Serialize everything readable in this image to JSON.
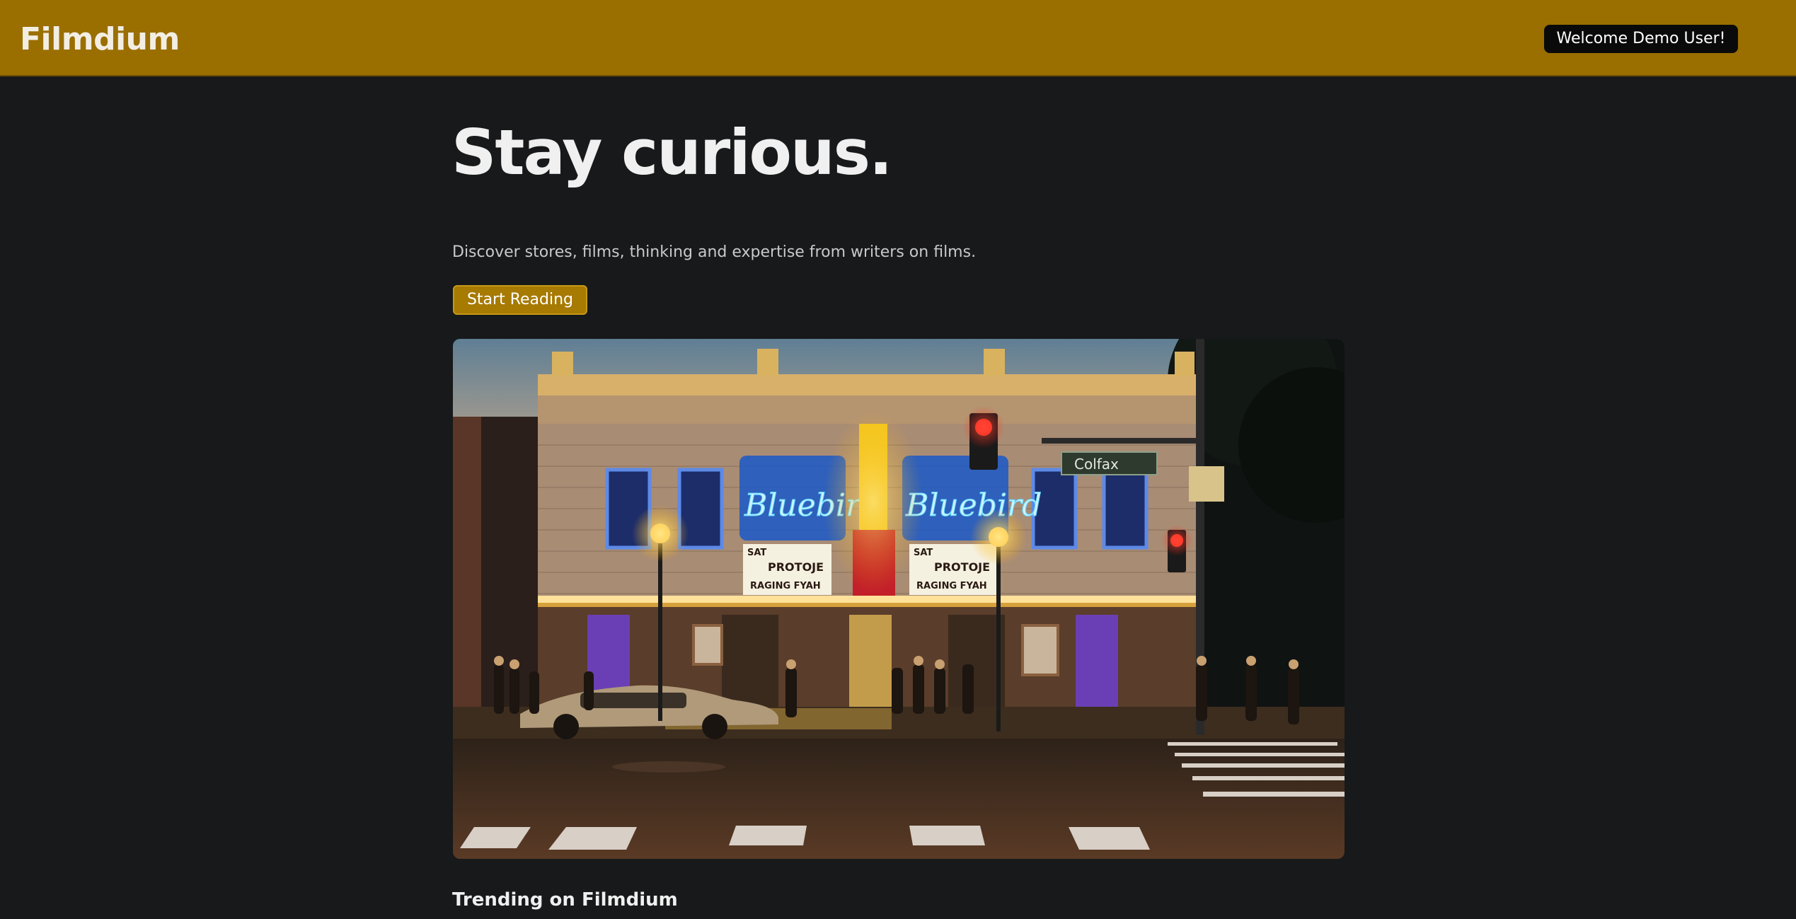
{
  "header": {
    "brand": "Filmdium",
    "welcome_label": "Welcome Demo User!"
  },
  "hero": {
    "title": "Stay curious.",
    "tagline": "Discover stores, films, thinking and expertise from writers on films.",
    "cta_label": "Start Reading",
    "image": {
      "sign_left": "Bluebird",
      "sign_right": "Bluebird",
      "marquee_left": [
        "SAT",
        "PROTOJE",
        "RAGING FYAH"
      ],
      "marquee_right": [
        "SAT",
        "PROTOJE",
        "RAGING FYAH"
      ],
      "street_sign": "Colfax"
    }
  },
  "trending": {
    "title": "Trending on Filmdium"
  },
  "colors": {
    "nav": "#9a6f00",
    "accent": "#a77a02",
    "background": "#17191a"
  }
}
